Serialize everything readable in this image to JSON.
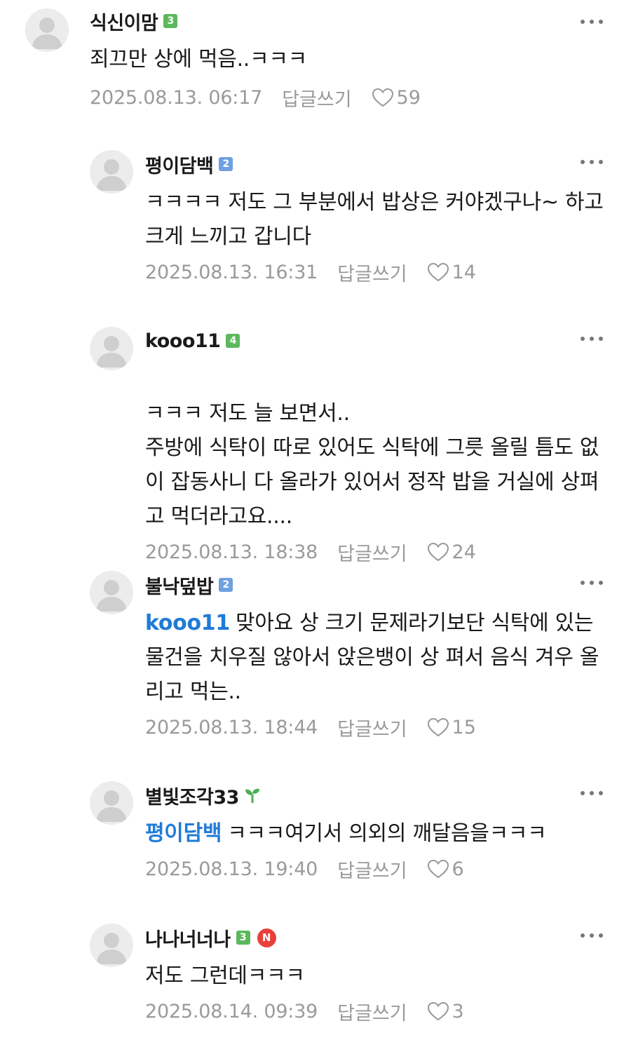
{
  "comments": [
    {
      "nickname": "식신이맘",
      "level": "3",
      "level_color": "#5cb85c",
      "text": "죄끄만 상에 먹음..ㅋㅋㅋ",
      "mention": "",
      "date": "2025.08.13. 06:17",
      "reply_label": "답글쓰기",
      "likes": "59"
    },
    {
      "nickname": "평이담백",
      "level": "2",
      "level_color": "#6fa0e0",
      "text": "ㅋㅋㅋㅋ 저도 그 부분에서 밥상은 커야겠구나~ 하고 크게 느끼고 갑니다",
      "mention": "",
      "date": "2025.08.13. 16:31",
      "reply_label": "답글쓰기",
      "likes": "14"
    },
    {
      "nickname": "kooo11",
      "level": "4",
      "level_color": "#5cb85c",
      "text": "ㅋㅋㅋ 저도 늘 보면서..\n주방에 식탁이 따로 있어도 식탁에 그릇 올릴 틈도 없이 잡동사니 다 올라가 있어서 정작 밥을 거실에 상펴고 먹더라고요....",
      "mention": "",
      "date": "2025.08.13. 18:38",
      "reply_label": "답글쓰기",
      "likes": "24"
    },
    {
      "nickname": "불낙덮밥",
      "level": "2",
      "level_color": "#6fa0e0",
      "text": "맞아요 상 크기 문제라기보단 식탁에 있는 물건을 치우질 않아서 앉은뱅이 상 펴서 음식 겨우 올리고 먹는..",
      "mention": "kooo11",
      "date": "2025.08.13. 18:44",
      "reply_label": "답글쓰기",
      "likes": "15"
    },
    {
      "nickname": "별빛조각33",
      "level": "",
      "level_color": "#5cb85c",
      "sprout": true,
      "text": "ㅋㅋㅋ여기서 의외의 깨달음을ㅋㅋㅋ",
      "mention": "평이담백",
      "date": "2025.08.13. 19:40",
      "reply_label": "답글쓰기",
      "likes": "6"
    },
    {
      "nickname": "나나너너나",
      "level": "3",
      "level_color": "#5cb85c",
      "n_badge": "N",
      "text": "저도 그런데ㅋㅋㅋ",
      "mention": "",
      "date": "2025.08.14. 09:39",
      "reply_label": "답글쓰기",
      "likes": "3"
    }
  ],
  "icons": {
    "more": "more-dots-icon",
    "like": "heart-outline-icon",
    "avatar": "default-profile-icon",
    "sprout": "sprout-icon"
  }
}
